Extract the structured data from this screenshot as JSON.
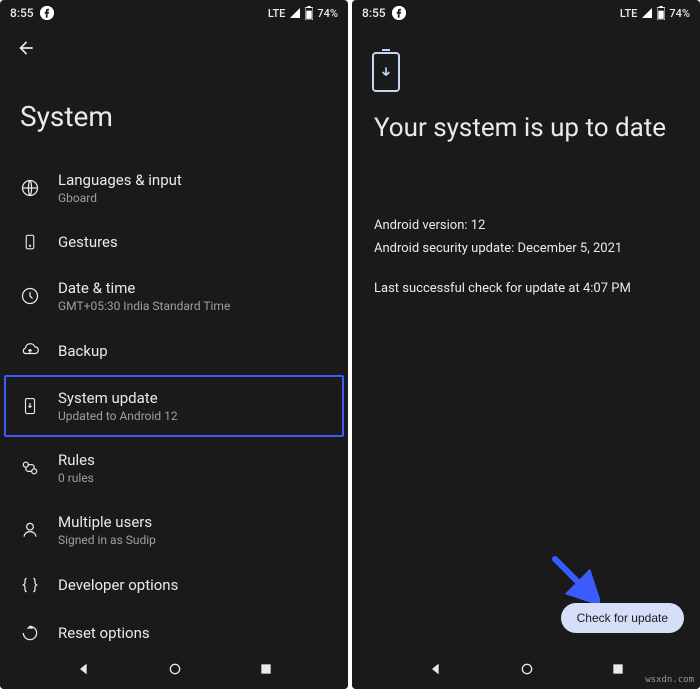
{
  "statusBar": {
    "time": "8:55",
    "network": "LTE",
    "battery": "74%"
  },
  "leftScreen": {
    "title": "System",
    "items": [
      {
        "title": "Languages & input",
        "subtitle": "Gboard"
      },
      {
        "title": "Gestures",
        "subtitle": ""
      },
      {
        "title": "Date & time",
        "subtitle": "GMT+05:30 India Standard Time"
      },
      {
        "title": "Backup",
        "subtitle": ""
      },
      {
        "title": "System update",
        "subtitle": "Updated to Android 12"
      },
      {
        "title": "Rules",
        "subtitle": "0 rules"
      },
      {
        "title": "Multiple users",
        "subtitle": "Signed in as Sudip"
      },
      {
        "title": "Developer options",
        "subtitle": ""
      },
      {
        "title": "Reset options",
        "subtitle": ""
      }
    ]
  },
  "rightScreen": {
    "heading": "Your system is up to date",
    "versionLine": "Android version: 12",
    "securityLine": "Android security update: December 5, 2021",
    "lastCheckLine": "Last successful check for update at 4:07 PM",
    "checkButton": "Check for update"
  },
  "watermark": "wsxdn.com"
}
